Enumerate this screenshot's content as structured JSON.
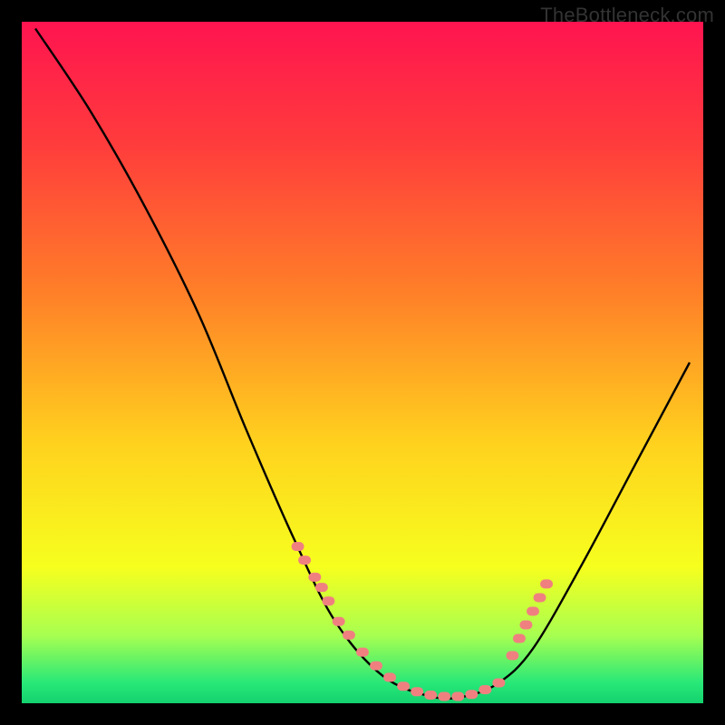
{
  "watermark": "TheBottleneck.com",
  "chart_data": {
    "type": "line",
    "title": "",
    "xlabel": "",
    "ylabel": "",
    "xlim": [
      0,
      100
    ],
    "ylim": [
      0,
      100
    ],
    "background": {
      "type": "vertical-gradient",
      "stops": [
        {
          "offset": 0.0,
          "color": "#ff1450"
        },
        {
          "offset": 0.18,
          "color": "#ff3c3c"
        },
        {
          "offset": 0.4,
          "color": "#ff8028"
        },
        {
          "offset": 0.62,
          "color": "#ffd21e"
        },
        {
          "offset": 0.8,
          "color": "#f6ff1e"
        },
        {
          "offset": 0.9,
          "color": "#a8ff50"
        },
        {
          "offset": 0.97,
          "color": "#28e878"
        },
        {
          "offset": 1.0,
          "color": "#14d26e"
        }
      ]
    },
    "series": [
      {
        "name": "bottleneck-curve",
        "type": "line",
        "stroke": "#000000",
        "values": [
          {
            "x": 2,
            "y": 99
          },
          {
            "x": 10,
            "y": 87
          },
          {
            "x": 18,
            "y": 73
          },
          {
            "x": 26,
            "y": 57
          },
          {
            "x": 33,
            "y": 40
          },
          {
            "x": 40,
            "y": 24
          },
          {
            "x": 46,
            "y": 12
          },
          {
            "x": 53,
            "y": 4
          },
          {
            "x": 60,
            "y": 1
          },
          {
            "x": 65,
            "y": 1
          },
          {
            "x": 70,
            "y": 3
          },
          {
            "x": 75,
            "y": 8
          },
          {
            "x": 82,
            "y": 20
          },
          {
            "x": 90,
            "y": 35
          },
          {
            "x": 98,
            "y": 50
          }
        ]
      },
      {
        "name": "highlight-dots",
        "type": "scatter",
        "fill": "#f08080",
        "values": [
          {
            "x": 40.5,
            "y": 23
          },
          {
            "x": 41.5,
            "y": 21
          },
          {
            "x": 43,
            "y": 18.5
          },
          {
            "x": 44,
            "y": 17
          },
          {
            "x": 45,
            "y": 15
          },
          {
            "x": 46.5,
            "y": 12
          },
          {
            "x": 48,
            "y": 10
          },
          {
            "x": 50,
            "y": 7.5
          },
          {
            "x": 52,
            "y": 5.5
          },
          {
            "x": 54,
            "y": 3.8
          },
          {
            "x": 56,
            "y": 2.5
          },
          {
            "x": 58,
            "y": 1.7
          },
          {
            "x": 60,
            "y": 1.2
          },
          {
            "x": 62,
            "y": 1.0
          },
          {
            "x": 64,
            "y": 1.0
          },
          {
            "x": 66,
            "y": 1.3
          },
          {
            "x": 68,
            "y": 2.0
          },
          {
            "x": 70,
            "y": 3.0
          },
          {
            "x": 72,
            "y": 7.0
          },
          {
            "x": 73,
            "y": 9.5
          },
          {
            "x": 74,
            "y": 11.5
          },
          {
            "x": 75,
            "y": 13.5
          },
          {
            "x": 76,
            "y": 15.5
          },
          {
            "x": 77,
            "y": 17.5
          }
        ]
      }
    ]
  }
}
